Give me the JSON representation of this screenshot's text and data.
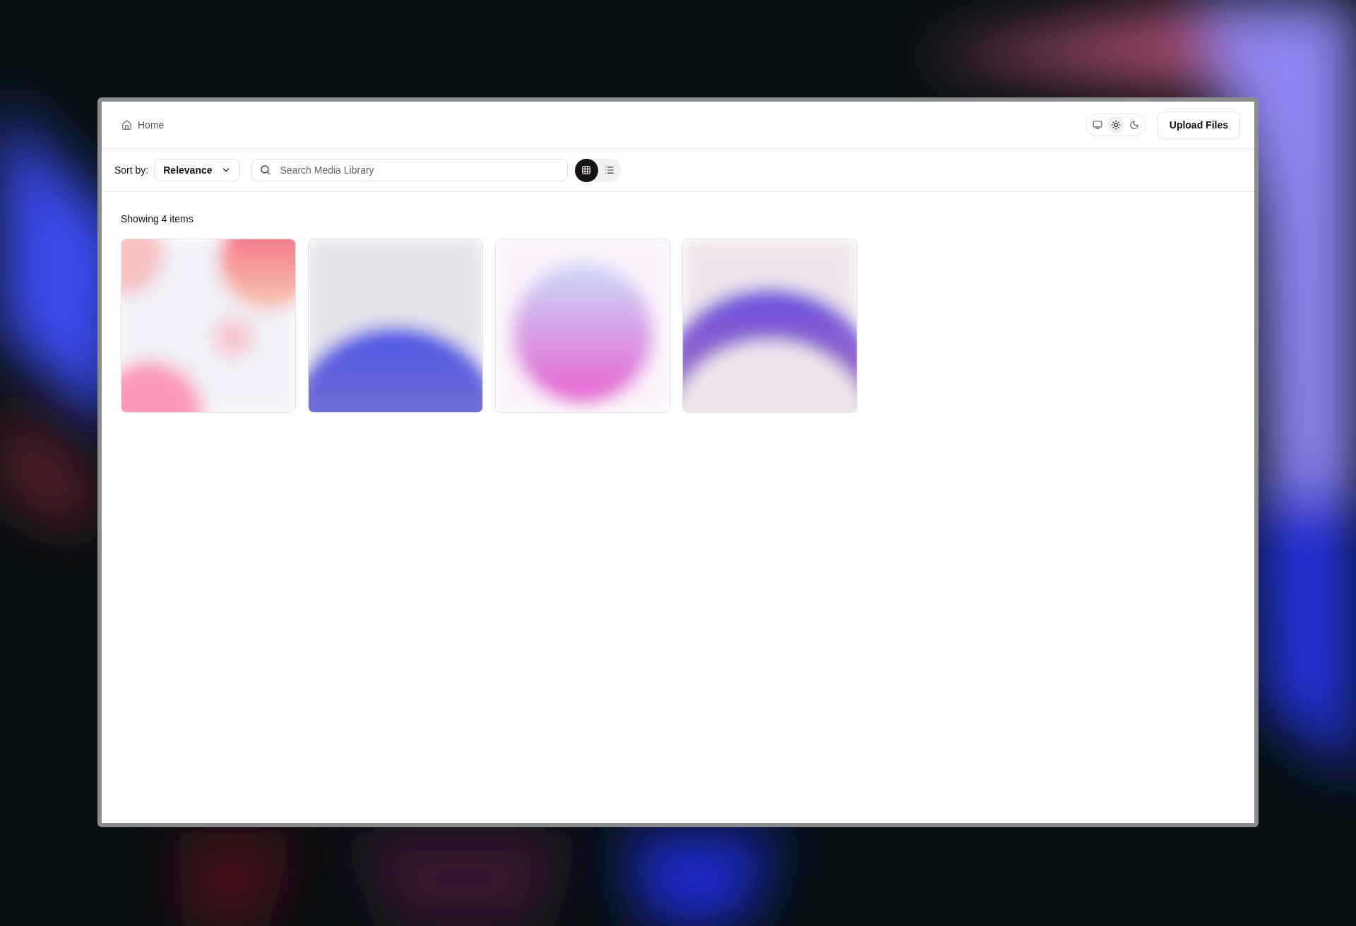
{
  "breadcrumb": {
    "label": "Home"
  },
  "theme_toggle": [
    {
      "kind": "system",
      "selected": false
    },
    {
      "kind": "light",
      "selected": true
    },
    {
      "kind": "dark",
      "selected": false
    }
  ],
  "upload_button": "Upload Files",
  "sort": {
    "label": "Sort by:",
    "value": "Relevance"
  },
  "search": {
    "placeholder": "Search Media Library"
  },
  "view_toggle": [
    {
      "kind": "grid",
      "selected": true
    },
    {
      "kind": "list",
      "selected": false
    }
  ],
  "count_label": "Showing 4 items"
}
